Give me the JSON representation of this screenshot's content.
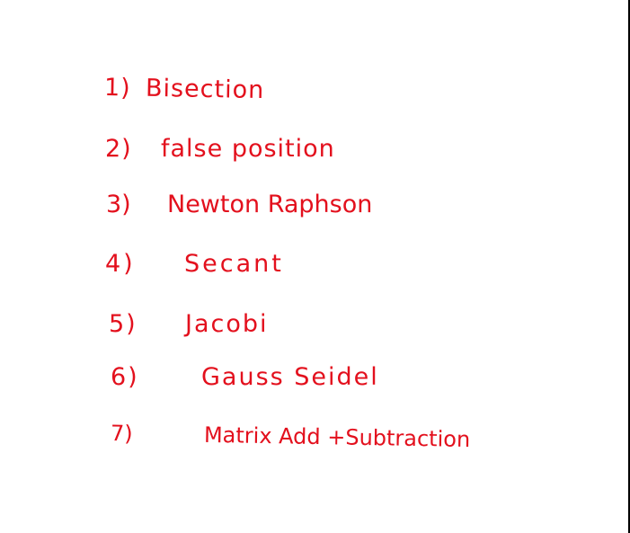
{
  "note": {
    "ink_color": "#e3101d",
    "background_color": "#ffffff",
    "items": [
      {
        "number": "1)",
        "text": "Bisection"
      },
      {
        "number": "2)",
        "text": "false position"
      },
      {
        "number": "3)",
        "text": "Newton Raphson"
      },
      {
        "number": "4)",
        "text": "Secant"
      },
      {
        "number": "5)",
        "text": "Jacobi"
      },
      {
        "number": "6)",
        "text": "Gauss Seidel"
      },
      {
        "number": "7)",
        "text": "Matrix Add +Subtraction"
      }
    ]
  }
}
